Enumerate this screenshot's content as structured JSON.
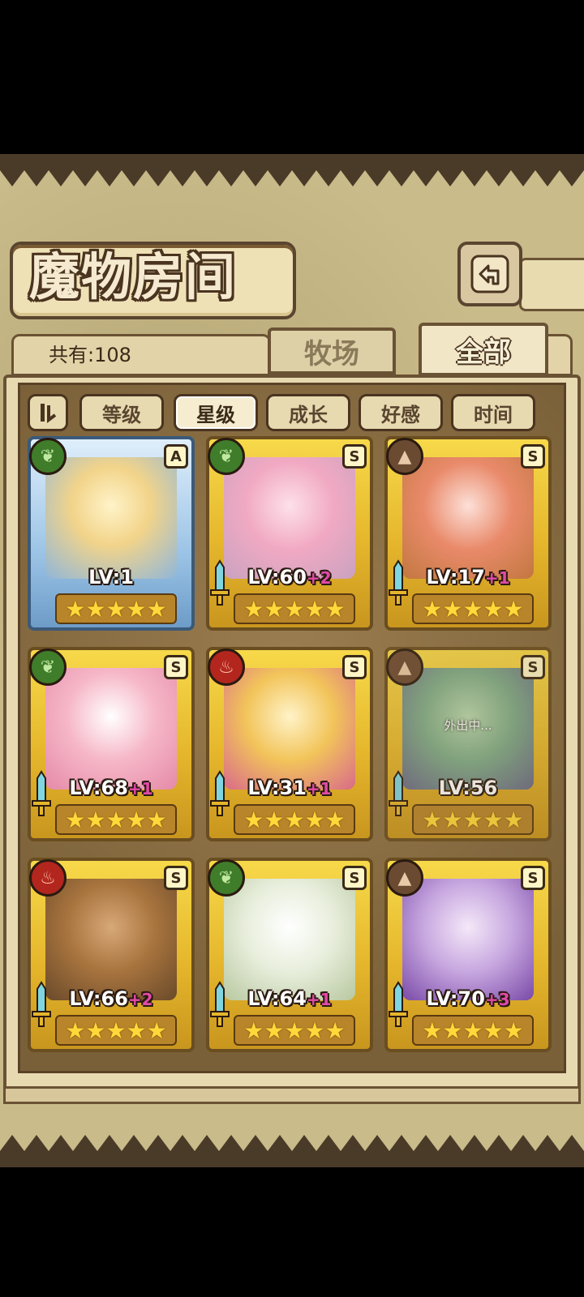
{
  "header": {
    "title": "魔物房间"
  },
  "counter": {
    "text": "共有:108"
  },
  "tabs": [
    {
      "label": "牧场",
      "active": false
    },
    {
      "label": "全部",
      "active": true
    }
  ],
  "sort_buttons": [
    {
      "label": "等级",
      "active": false
    },
    {
      "label": "星级",
      "active": true
    },
    {
      "label": "成长",
      "active": false
    },
    {
      "label": "好感",
      "active": false
    },
    {
      "label": "时间",
      "active": false
    }
  ],
  "monsters": [
    {
      "level": "LV:1",
      "plus": "",
      "rank": "A",
      "element": "leaf-icon",
      "frame": "blue",
      "stars": 5,
      "status": ""
    },
    {
      "level": "LV:60",
      "plus": "+2",
      "rank": "S",
      "element": "leaf-icon",
      "frame": "gold",
      "stars": 5,
      "status": ""
    },
    {
      "level": "LV:17",
      "plus": "+1",
      "rank": "S",
      "element": "rock-icon",
      "frame": "gold",
      "stars": 5,
      "status": ""
    },
    {
      "level": "LV:68",
      "plus": "+1",
      "rank": "S",
      "element": "leaf-icon",
      "frame": "gold",
      "stars": 5,
      "status": ""
    },
    {
      "level": "LV:31",
      "plus": "+1",
      "rank": "S",
      "element": "fire-icon",
      "frame": "gold",
      "stars": 5,
      "status": ""
    },
    {
      "level": "LV:56",
      "plus": "",
      "rank": "S",
      "element": "rock-icon",
      "frame": "gold",
      "stars": 5,
      "status": "外出中..."
    },
    {
      "level": "LV:66",
      "plus": "+2",
      "rank": "S",
      "element": "fire-icon",
      "frame": "gold",
      "stars": 5,
      "status": ""
    },
    {
      "level": "LV:64",
      "plus": "+1",
      "rank": "S",
      "element": "leaf-icon",
      "frame": "gold",
      "stars": 5,
      "status": ""
    },
    {
      "level": "LV:70",
      "plus": "+3",
      "rank": "S",
      "element": "rock-icon",
      "frame": "gold",
      "stars": 5,
      "status": ""
    }
  ],
  "colors": {
    "leaf": "#3f7d2a",
    "fire": "#b3261e",
    "rock": "#6b4a32",
    "plus": "#e04aa8",
    "gold": "#f2cd3c"
  }
}
